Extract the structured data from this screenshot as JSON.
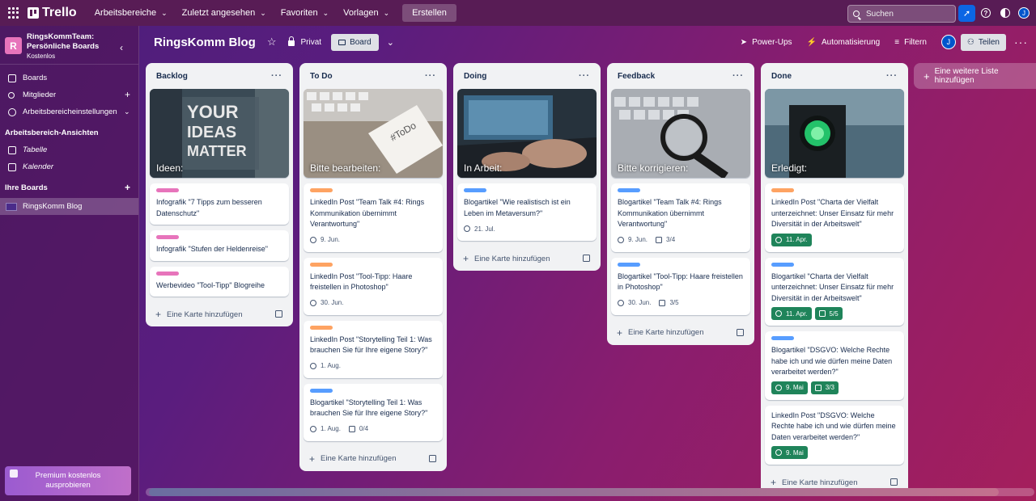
{
  "nav": {
    "logo": "Trello",
    "menu": [
      {
        "label": "Arbeitsbereiche",
        "chevron": "chevron-down"
      },
      {
        "label": "Zuletzt angesehen",
        "chevron": "chevron-down"
      },
      {
        "label": "Favoriten",
        "chevron": "chevron-down"
      },
      {
        "label": "Vorlagen",
        "chevron": "chevron-down"
      }
    ],
    "create_label": "Erstellen",
    "search_placeholder": "Suchen",
    "avatar_initial": "J"
  },
  "sidebar": {
    "workspace_initial": "R",
    "workspace_name": "RingsKommTeam: Persönliche Boards",
    "workspace_plan": "Kostenlos",
    "items": [
      {
        "label": "Boards",
        "icon": "boards-icon"
      },
      {
        "label": "Mitglieder",
        "icon": "members-icon"
      },
      {
        "label": "Arbeitsbereicheinstellungen",
        "icon": "gear-icon"
      }
    ],
    "views_heading": "Arbeitsbereich-Ansichten",
    "views": [
      {
        "label": "Tabelle",
        "icon": "table-icon"
      },
      {
        "label": "Kalender",
        "icon": "calendar-icon"
      }
    ],
    "boards_heading": "Ihre Boards",
    "boards": [
      {
        "label": "RingsKomm Blog"
      }
    ],
    "premium_label": "Premium kostenlos ausprobieren"
  },
  "board": {
    "title": "RingsKomm Blog",
    "visibility": "Privat",
    "view_label": "Board",
    "powerups_label": "Power-Ups",
    "automation_label": "Automatisierung",
    "filter_label": "Filtern",
    "member_initial": "J",
    "share_label": "Teilen",
    "add_list_label": "Eine weitere Liste hinzufügen"
  },
  "add_card_label": "Eine Karte hinzufügen",
  "colors": {
    "green": "#4bce97",
    "orange": "#fea362",
    "blue": "#579dff",
    "pink": "#e774bb",
    "done_badge": "#1f845a"
  },
  "lists": [
    {
      "title": "Backlog",
      "cover": {
        "title": "Ideen:",
        "image": "your-ideas-matter-photo"
      },
      "cards": [
        {
          "label": "pink",
          "text": "Infografik \"7 Tipps zum besseren Datenschutz\""
        },
        {
          "label": "pink",
          "text": "Infografik \"Stufen der Heldenreise\""
        },
        {
          "label": "pink",
          "text": "Werbevideo \"Tool-Tipp\" Blogreihe"
        }
      ]
    },
    {
      "title": "To Do",
      "cover": {
        "title": "Bitte bearbeiten:",
        "image": "todo-notebook-photo"
      },
      "cards": [
        {
          "label": "orange",
          "text": "LinkedIn Post \"Team Talk #4: Rings Kommunikation übernimmt Verantwortung\"",
          "due": "9. Jun."
        },
        {
          "label": "orange",
          "text": "LinkedIn Post \"Tool-Tipp: Haare freistellen in Photoshop\"",
          "due": "30. Jun."
        },
        {
          "label": "orange",
          "text": "LinkedIn Post \"Storytelling Teil 1: Was brauchen Sie für Ihre eigene Story?\"",
          "due": "1. Aug."
        },
        {
          "label": "blue",
          "text": "Blogartikel \"Storytelling Teil 1: Was brauchen Sie für Ihre eigene Story?\"",
          "due": "1. Aug.",
          "checklist": "0/4"
        }
      ]
    },
    {
      "title": "Doing",
      "cover": {
        "title": "In Arbeit:",
        "image": "laptop-typing-photo"
      },
      "cards": [
        {
          "label": "blue",
          "text": "Blogartikel \"Wie realistisch ist ein Leben im Metaversum?\"",
          "due": "21. Jul."
        }
      ]
    },
    {
      "title": "Feedback",
      "cover": {
        "title": "Bitte korrigieren:",
        "image": "magnifier-keyboard-photo"
      },
      "cards": [
        {
          "label": "blue",
          "text": "Blogartikel \"Team Talk #4: Rings Kommunikation übernimmt Verantwortung\"",
          "due": "9. Jun.",
          "checklist": "3/4"
        },
        {
          "label": "blue",
          "text": "Blogartikel \"Tool-Tipp: Haare freistellen in Photoshop\"",
          "due": "30. Jun.",
          "checklist": "3/5"
        }
      ]
    },
    {
      "title": "Done",
      "cover": {
        "title": "Erledigt:",
        "image": "green-traffic-light-photo"
      },
      "cards": [
        {
          "label": "orange",
          "text": "LinkedIn Post \"Charta der Vielfalt unterzeichnet: Unser Einsatz für mehr Diversität in der Arbeitswelt\"",
          "due": "11. Apr.",
          "due_done": true
        },
        {
          "label": "blue",
          "text": "Blogartikel \"Charta der Vielfalt unterzeichnet: Unser Einsatz für mehr Diversität in der Arbeitswelt\"",
          "due": "11. Apr.",
          "due_done": true,
          "checklist": "5/5",
          "checklist_done": true
        },
        {
          "label": "blue",
          "text": "Blogartikel \"DSGVO: Welche Rechte habe ich und wie dürfen meine Daten verarbeitet werden?\"",
          "due": "9. Mai",
          "due_done": true,
          "checklist": "3/3",
          "checklist_done": true
        },
        {
          "text": "LinkedIn Post \"DSGVO: Welche Rechte habe ich und wie dürfen meine Daten verarbeitet werden?\"",
          "due": "9. Mai",
          "due_done": true
        }
      ]
    }
  ]
}
